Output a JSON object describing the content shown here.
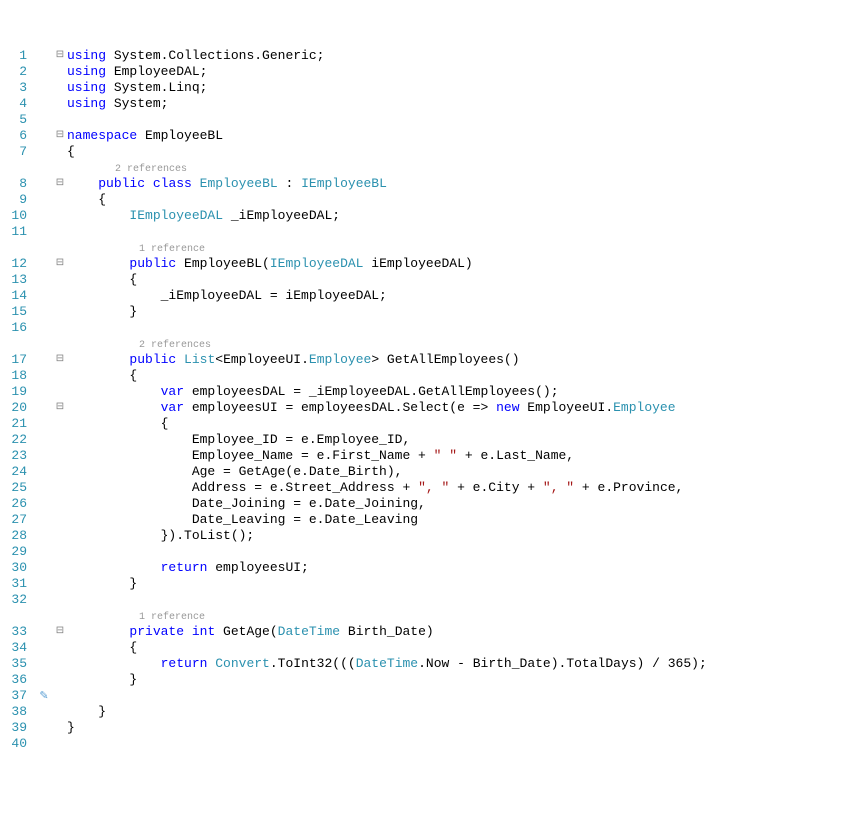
{
  "lines": {
    "1": [
      [
        "kw",
        "using"
      ],
      [
        "",
        " System.Collections.Generic;"
      ]
    ],
    "2": [
      [
        "kw",
        "using"
      ],
      [
        "",
        " EmployeeDAL;"
      ]
    ],
    "3": [
      [
        "kw",
        "using"
      ],
      [
        "",
        " System.Linq;"
      ]
    ],
    "4": [
      [
        "kw",
        "using"
      ],
      [
        "",
        " System;"
      ]
    ],
    "5": [],
    "6": [
      [
        "kw",
        "namespace"
      ],
      [
        "",
        " EmployeeBL"
      ]
    ],
    "7": [
      [
        "",
        "{"
      ]
    ],
    "lens1": [
      [
        "lens",
        "        2 references"
      ]
    ],
    "8": [
      [
        "",
        "    "
      ],
      [
        "kw",
        "public"
      ],
      [
        "",
        " "
      ],
      [
        "kw",
        "class"
      ],
      [
        "",
        " "
      ],
      [
        "type",
        "EmployeeBL"
      ],
      [
        "",
        " : "
      ],
      [
        "type",
        "IEmployeeBL"
      ]
    ],
    "9": [
      [
        "",
        "    {"
      ]
    ],
    "10": [
      [
        "",
        "        "
      ],
      [
        "type",
        "IEmployeeDAL"
      ],
      [
        "",
        " _iEmployeeDAL;"
      ]
    ],
    "11": [],
    "lens2": [
      [
        "lens",
        "            1 reference"
      ]
    ],
    "12": [
      [
        "",
        "        "
      ],
      [
        "kw",
        "public"
      ],
      [
        "",
        " EmployeeBL("
      ],
      [
        "type",
        "IEmployeeDAL"
      ],
      [
        "",
        " iEmployeeDAL)"
      ]
    ],
    "13": [
      [
        "",
        "        {"
      ]
    ],
    "14": [
      [
        "",
        "            _iEmployeeDAL = iEmployeeDAL;"
      ]
    ],
    "15": [
      [
        "",
        "        }"
      ]
    ],
    "16": [],
    "lens3": [
      [
        "lens",
        "            2 references"
      ]
    ],
    "17": [
      [
        "",
        "        "
      ],
      [
        "kw",
        "public"
      ],
      [
        "",
        " "
      ],
      [
        "type",
        "List"
      ],
      [
        "",
        "<EmployeeUI."
      ],
      [
        "type",
        "Employee"
      ],
      [
        "",
        "> GetAllEmployees()"
      ]
    ],
    "18": [
      [
        "",
        "        {"
      ]
    ],
    "19": [
      [
        "",
        "            "
      ],
      [
        "kw",
        "var"
      ],
      [
        "",
        " employeesDAL = _iEmployeeDAL.GetAllEmployees();"
      ]
    ],
    "20": [
      [
        "",
        "            "
      ],
      [
        "kw",
        "var"
      ],
      [
        "",
        " employeesUI = employeesDAL.Select(e => "
      ],
      [
        "kw",
        "new"
      ],
      [
        "",
        " EmployeeUI."
      ],
      [
        "type",
        "Employee"
      ]
    ],
    "21": [
      [
        "",
        "            {"
      ]
    ],
    "22": [
      [
        "",
        "                Employee_ID = e.Employee_ID,"
      ]
    ],
    "23": [
      [
        "",
        "                Employee_Name = e.First_Name + "
      ],
      [
        "str",
        "\" \""
      ],
      [
        "",
        " + e.Last_Name,"
      ]
    ],
    "24": [
      [
        "",
        "                Age = GetAge(e.Date_Birth),"
      ]
    ],
    "25": [
      [
        "",
        "                Address = e.Street_Address + "
      ],
      [
        "str",
        "\", \""
      ],
      [
        "",
        " + e.City + "
      ],
      [
        "str",
        "\", \""
      ],
      [
        "",
        " + e.Province,"
      ]
    ],
    "26": [
      [
        "",
        "                Date_Joining = e.Date_Joining,"
      ]
    ],
    "27": [
      [
        "",
        "                Date_Leaving = e.Date_Leaving"
      ]
    ],
    "28": [
      [
        "",
        "            }).ToList();"
      ]
    ],
    "29": [],
    "30": [
      [
        "",
        "            "
      ],
      [
        "kw",
        "return"
      ],
      [
        "",
        " employeesUI;"
      ]
    ],
    "31": [
      [
        "",
        "        }"
      ]
    ],
    "32": [],
    "lens4": [
      [
        "lens",
        "            1 reference"
      ]
    ],
    "33": [
      [
        "",
        "        "
      ],
      [
        "kw",
        "private"
      ],
      [
        "",
        " "
      ],
      [
        "kw",
        "int"
      ],
      [
        "",
        " GetAge("
      ],
      [
        "type",
        "DateTime"
      ],
      [
        "",
        " Birth_Date)"
      ]
    ],
    "34": [
      [
        "",
        "        {"
      ]
    ],
    "35": [
      [
        "",
        "            "
      ],
      [
        "kw",
        "return"
      ],
      [
        "",
        " "
      ],
      [
        "type",
        "Convert"
      ],
      [
        "",
        ".ToInt32((("
      ],
      [
        "type",
        "DateTime"
      ],
      [
        "",
        ".Now - Birth_Date).TotalDays) / 365);"
      ]
    ],
    "36": [
      [
        "",
        "        }"
      ]
    ],
    "37": [],
    "38": [
      [
        "",
        "    }"
      ]
    ],
    "39": [
      [
        "",
        "}"
      ]
    ],
    "40": []
  },
  "lineNumbers": [
    "1",
    "2",
    "3",
    "4",
    "5",
    "6",
    "7",
    "",
    "8",
    "9",
    "10",
    "11",
    "",
    "12",
    "13",
    "14",
    "15",
    "16",
    "",
    "17",
    "18",
    "19",
    "20",
    "21",
    "22",
    "23",
    "24",
    "25",
    "26",
    "27",
    "28",
    "29",
    "30",
    "31",
    "32",
    "",
    "33",
    "34",
    "35",
    "36",
    "37",
    "38",
    "39",
    "40"
  ],
  "folds": [
    "⊟",
    "",
    "",
    "",
    "",
    "⊟",
    "",
    "",
    "⊟",
    "",
    "",
    "",
    "",
    "⊟",
    "",
    "",
    "",
    "",
    "",
    "⊟",
    "",
    "",
    "⊟",
    "",
    "",
    "",
    "",
    "",
    "",
    "",
    "",
    "",
    "",
    "",
    "",
    "",
    "⊟",
    "",
    "",
    "",
    "",
    "",
    "",
    ""
  ],
  "margins": [
    "",
    "",
    "",
    "",
    "",
    "",
    "",
    "",
    "",
    "",
    "",
    "",
    "",
    "",
    "",
    "",
    "",
    "",
    "",
    "",
    "",
    "",
    "",
    "",
    "",
    "",
    "",
    "",
    "",
    "",
    "",
    "",
    "",
    "",
    "",
    "",
    "",
    "",
    "",
    "",
    "✎",
    "",
    "",
    ""
  ],
  "order": [
    "1",
    "2",
    "3",
    "4",
    "5",
    "6",
    "7",
    "lens1",
    "8",
    "9",
    "10",
    "11",
    "lens2",
    "12",
    "13",
    "14",
    "15",
    "16",
    "lens3",
    "17",
    "18",
    "19",
    "20",
    "21",
    "22",
    "23",
    "24",
    "25",
    "26",
    "27",
    "28",
    "29",
    "30",
    "31",
    "32",
    "lens4",
    "33",
    "34",
    "35",
    "36",
    "37",
    "38",
    "39",
    "40"
  ]
}
